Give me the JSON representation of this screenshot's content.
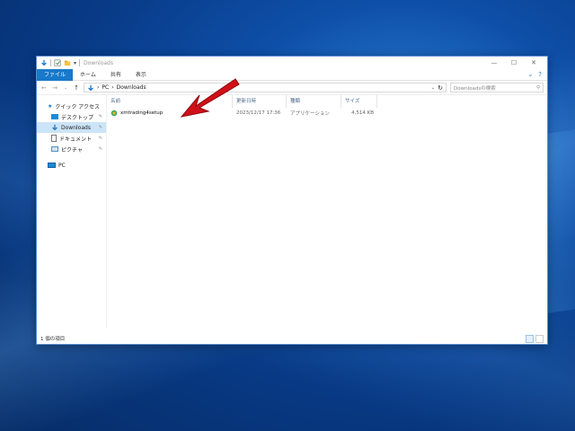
{
  "window": {
    "title": "Downloads",
    "controls": [
      "minimize-icon",
      "maximize-icon",
      "close-icon"
    ]
  },
  "ribbon": {
    "tabs": [
      "ファイル",
      "ホーム",
      "共有",
      "表示"
    ],
    "help_icon": "help-icon"
  },
  "address": {
    "path": [
      "PC",
      "Downloads"
    ],
    "search_placeholder": "Downloadsの検索"
  },
  "nav": {
    "quick_access": "クイック アクセス",
    "items": [
      {
        "label": "デスクトップ",
        "icon": "desktop-icon"
      },
      {
        "label": "Downloads",
        "icon": "download-icon"
      },
      {
        "label": "ドキュメント",
        "icon": "document-icon"
      },
      {
        "label": "ピクチャ",
        "icon": "picture-icon"
      }
    ],
    "pc": "PC"
  },
  "columns": {
    "name": "名前",
    "date": "更新日時",
    "type": "種類",
    "size": "サイズ"
  },
  "files": [
    {
      "name": "xmtrading4setup",
      "date": "2023/12/17 17:36",
      "type": "アプリケーション",
      "size": "4,514 KB"
    }
  ],
  "status": {
    "count": "1 個の項目"
  },
  "colors": {
    "accent": "#1979ca",
    "selection": "#cce4f7",
    "arrow": "#d01018"
  }
}
